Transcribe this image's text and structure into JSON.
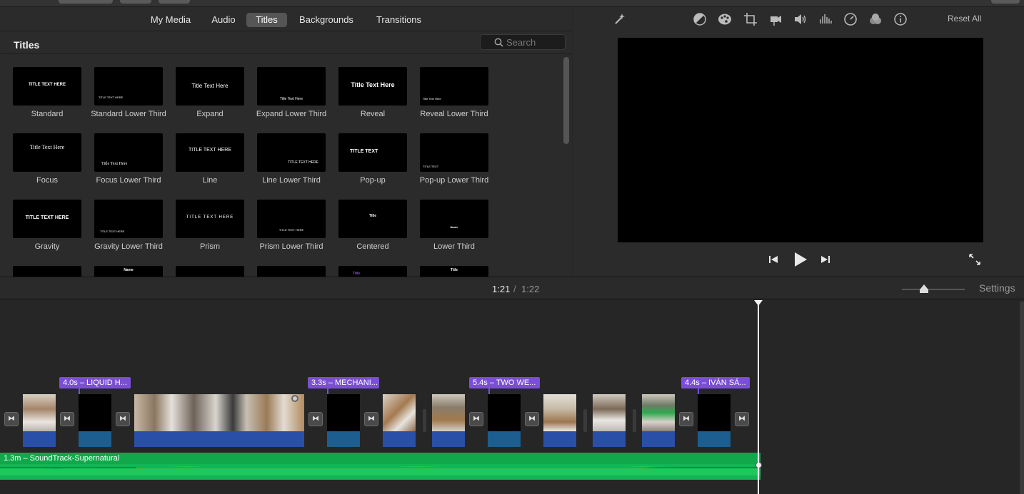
{
  "browser": {
    "tabs": [
      {
        "label": "My Media",
        "active": false
      },
      {
        "label": "Audio",
        "active": false
      },
      {
        "label": "Titles",
        "active": true
      },
      {
        "label": "Backgrounds",
        "active": false
      },
      {
        "label": "Transitions",
        "active": false
      }
    ],
    "section_title": "Titles",
    "search_placeholder": "Search",
    "titles": [
      {
        "label": "Standard",
        "preview": "TITLE TEXT HERE"
      },
      {
        "label": "Standard Lower Third",
        "preview": "TITLE TEXT HERE"
      },
      {
        "label": "Expand",
        "preview": "Title Text Here"
      },
      {
        "label": "Expand Lower Third",
        "preview": "Title Text Here"
      },
      {
        "label": "Reveal",
        "preview": "Title Text Here"
      },
      {
        "label": "Reveal Lower Third",
        "preview": "Title Text Here"
      },
      {
        "label": "Focus",
        "preview": "Title Text Here"
      },
      {
        "label": "Focus Lower Third",
        "preview": "Title Text Here"
      },
      {
        "label": "Line",
        "preview": "TITLE TEXT HERE"
      },
      {
        "label": "Line Lower Third",
        "preview": "TITLE TEXT HERE"
      },
      {
        "label": "Pop-up",
        "preview": "TITLE TEXT"
      },
      {
        "label": "Pop-up Lower Third",
        "preview": "TITLE TEXT"
      },
      {
        "label": "Gravity",
        "preview": "TITLE TEXT HERE"
      },
      {
        "label": "Gravity Lower Third",
        "preview": "TITLE TEXT HERE"
      },
      {
        "label": "Prism",
        "preview": "TITLE TEXT HERE"
      },
      {
        "label": "Prism Lower Third",
        "preview": "TITLE TEXT HERE"
      },
      {
        "label": "Centered",
        "preview": "Title"
      },
      {
        "label": "Lower Third",
        "preview": "Name"
      }
    ],
    "partial_row_previews": [
      "",
      "Name",
      "",
      "",
      "Title",
      "Title"
    ]
  },
  "viewer": {
    "reset_label": "Reset All",
    "tool_icons": [
      "enhance-wand-icon",
      "color-balance-icon",
      "color-correction-icon",
      "crop-icon",
      "stabilization-icon",
      "volume-icon",
      "noise-reduction-icon",
      "speed-icon",
      "clip-filter-icon",
      "info-icon"
    ]
  },
  "timebar": {
    "current": "1:21",
    "separator": "/",
    "total": "1:22",
    "settings_label": "Settings"
  },
  "timeline": {
    "title_tags": [
      {
        "label": "4.0s – LIQUID H..."
      },
      {
        "label": "3.3s – MECHANI..."
      },
      {
        "label": "5.4s – TWO WE..."
      },
      {
        "label": "4.4s – IVÁN SÁ..."
      }
    ],
    "audio_label": "1.3m – SoundTrack-Supernatural"
  },
  "colors": {
    "title_tag": "#7a4fd6",
    "audio_track": "#10a84a",
    "clip_base": "#2a4fa8"
  }
}
